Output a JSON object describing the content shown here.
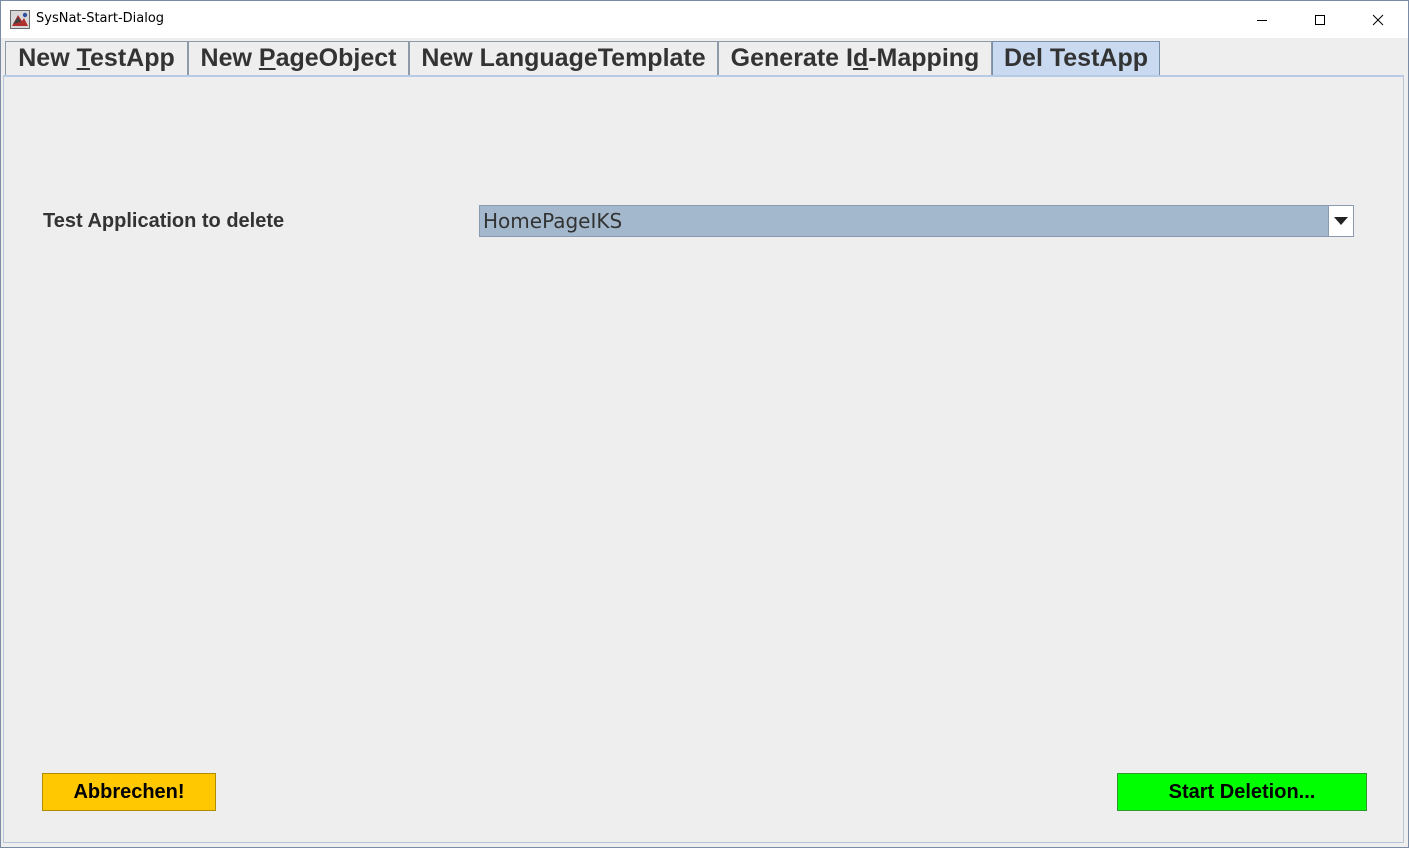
{
  "window": {
    "title": "SysNat-Start-Dialog",
    "controls": {
      "minimize": "minimize-icon",
      "maximize": "maximize-icon",
      "close": "close-icon"
    }
  },
  "tabs": [
    {
      "pre": "New ",
      "mnemonic": "T",
      "post": "estApp",
      "selected": false
    },
    {
      "pre": "New ",
      "mnemonic": "P",
      "post": "ageObject",
      "selected": false
    },
    {
      "pre": "New LanguageTemplate",
      "mnemonic": "",
      "post": "",
      "selected": false
    },
    {
      "pre": "Generate I",
      "mnemonic": "d",
      "post": "-Mapping",
      "selected": false
    },
    {
      "pre": "Del TestApp",
      "mnemonic": "",
      "post": "",
      "selected": true
    }
  ],
  "form": {
    "label": "Test Application to delete",
    "combo_value": "HomePageIKS"
  },
  "buttons": {
    "cancel_label": "Abbrechen!",
    "start_label": "Start Deletion..."
  },
  "colors": {
    "cancel_bg": "#ffc800",
    "start_bg": "#00ff00",
    "selected_tab": "#c9daf0",
    "combo_selection": "#a3b8cc"
  }
}
